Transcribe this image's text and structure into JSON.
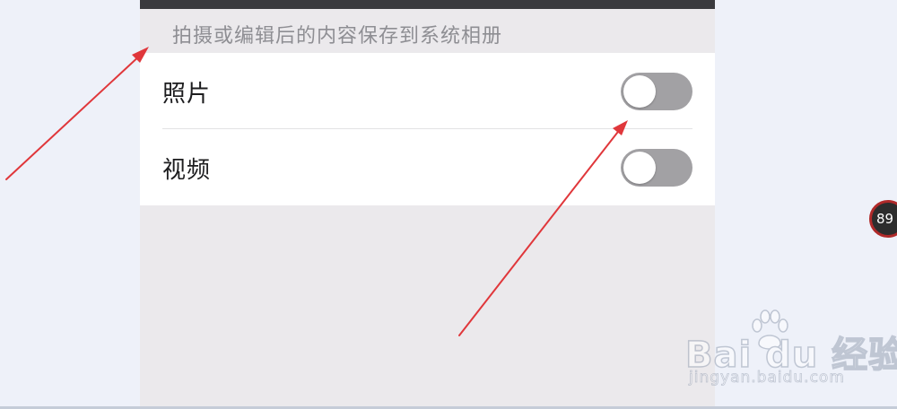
{
  "settings": {
    "section_header": "拍摄或编辑后的内容保存到系统相册",
    "rows": [
      {
        "label": "照片",
        "toggle_on": false
      },
      {
        "label": "视频",
        "toggle_on": false
      }
    ]
  },
  "overlay": {
    "badge_text": "89",
    "watermark_logo": "Bai du 经验",
    "watermark_url": "jingyan.baidu.com"
  },
  "colors": {
    "page_background": "#eef1f9",
    "settings_background": "#ebe9ec",
    "toggle_off": "#a2a1a4",
    "annotation_arrow": "#e0373b"
  }
}
